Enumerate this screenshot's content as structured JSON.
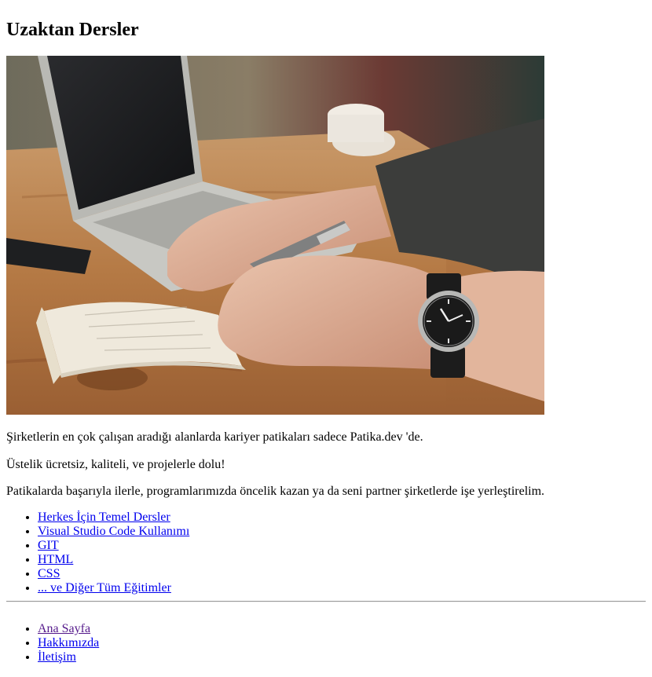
{
  "heading": "Uzaktan Dersler",
  "hero_image": {
    "icon": "laptop-writing-photo"
  },
  "paragraphs": [
    "Şirketlerin en çok çalışan aradığı alanlarda kariyer patikaları sadece Patika.dev 'de.",
    "Üstelik ücretsiz, kaliteli, ve projelerle dolu!",
    "Patikalarda başarıyla ilerle, programlarımızda öncelik kazan ya da seni partner şirketlerde işe yerleştirelim."
  ],
  "courses": [
    "Herkes İçin Temel Dersler",
    "Visual Studio Code Kullanımı",
    "GIT",
    "HTML",
    "CSS",
    "... ve Diğer Tüm Eğitimler"
  ],
  "nav": [
    "Ana Sayfa",
    "Hakkımızda",
    "İletişim"
  ],
  "colors": {
    "link": "#0000ee",
    "visited_link": "#551a8b"
  }
}
